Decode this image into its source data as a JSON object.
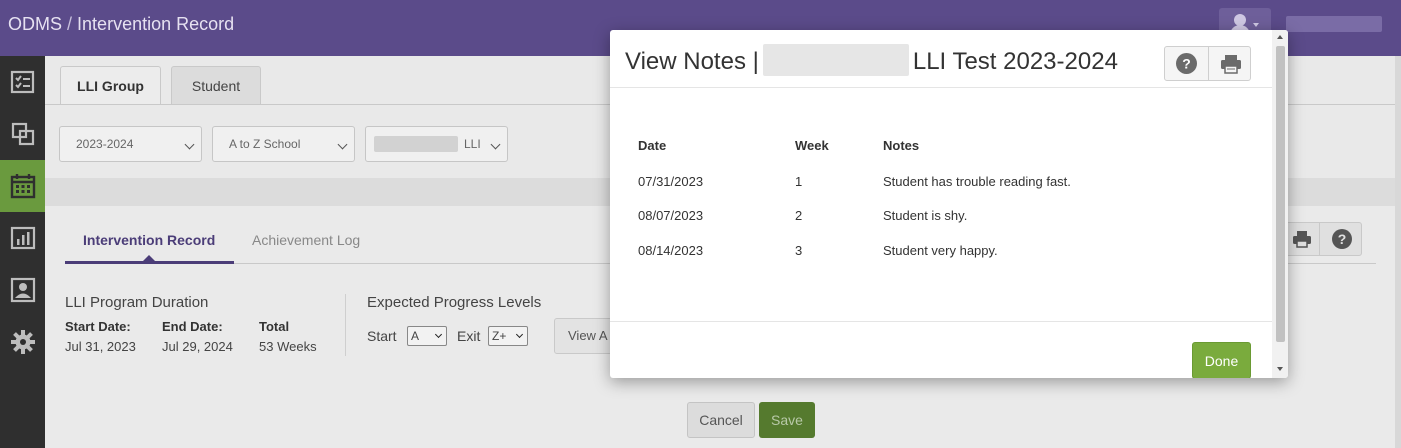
{
  "header": {
    "app_name": "ODMS",
    "separator": "/",
    "page_name": "Intervention Record"
  },
  "top_tabs": [
    {
      "label": "LLI Group",
      "active": true
    },
    {
      "label": "Student",
      "active": false
    }
  ],
  "filters": {
    "year": "2023-2024",
    "school": "A to Z School",
    "group_suffix": "LLI"
  },
  "inner_tabs": [
    {
      "label": "Intervention Record",
      "active": true
    },
    {
      "label": "Achievement Log",
      "active": false
    }
  ],
  "duration": {
    "title": "LLI Program Duration",
    "start_label": "Start Date:",
    "start_value": "Jul 31, 2023",
    "end_label": "End Date:",
    "end_value": "Jul 29, 2024",
    "total_label": "Total",
    "total_value": "53 Weeks"
  },
  "expected": {
    "title": "Expected Progress Levels",
    "start_label": "Start",
    "start_value": "A",
    "exit_label": "Exit",
    "exit_value": "Z+",
    "view_button": "View A"
  },
  "form_actions": {
    "cancel": "Cancel",
    "save": "Save"
  },
  "modal": {
    "title_prefix": "View Notes |",
    "title_suffix": "LLI Test 2023-2024",
    "columns": {
      "date": "Date",
      "week": "Week",
      "notes": "Notes"
    },
    "rows": [
      {
        "date": "07/31/2023",
        "week": "1",
        "notes": "Student has trouble reading fast."
      },
      {
        "date": "08/07/2023",
        "week": "2",
        "notes": "Student is shy."
      },
      {
        "date": "08/14/2023",
        "week": "3",
        "notes": "Student very happy."
      }
    ],
    "done_label": "Done"
  },
  "icons": {
    "nav": [
      "checklist-icon",
      "copy-icon",
      "calendar-icon",
      "bar-chart-icon",
      "id-card-icon",
      "gear-icon"
    ],
    "help": "help-icon",
    "print": "printer-icon",
    "user": "user-icon"
  },
  "colors": {
    "topbar": "#5b4b8a",
    "nav_bg": "#2f2f2f",
    "nav_active": "#6a9a3e",
    "accent": "#4b3d78",
    "done_button": "#7aab3d",
    "save_button": "#557a2e"
  }
}
